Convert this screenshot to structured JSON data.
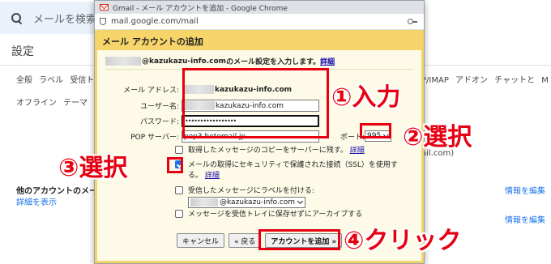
{
  "background": {
    "search_placeholder": "メールを検索",
    "settings_title": "設定",
    "tabs_row1_left": "全般 ラベル 受信ト",
    "tabs_row1_right": "P/IMAP アドオン チャットと M",
    "tabs_row2": "オフライン テーマ",
    "other_accounts_label": "他のアカウントのメー",
    "show_details_link": "詳細を表示",
    "edit_info_1": "情報を編集",
    "edit_info_2": "情報を編集",
    "email_suffix": "ail.com)"
  },
  "browser": {
    "title": "Gmail - メール アカウントを追加 - Google Chrome",
    "url": "mail.google.com/mail"
  },
  "dialog": {
    "header": "メール アカウントの追加",
    "intro_domain": "@kazukazu-info.com",
    "intro_text": " のメール設定を入力します。",
    "details_link": "詳細",
    "fields": {
      "email_label": "メール アドレス:",
      "email_value": "kazukazu-info.com",
      "username_label": "ユーザー名:",
      "username_value": "kazukazu-info.com",
      "password_label": "パスワード:",
      "password_value": "•••••••••••••••••",
      "pop_label": "POP サーバー:",
      "pop_value": "pop3.hetemail.jp",
      "port_label": "ポート:",
      "port_value": "995"
    },
    "options": {
      "leave_copy": "取得したメッセージのコピーをサーバーに残す。",
      "leave_copy_link": "詳細",
      "ssl_line1": "メールの取得にセキュリティで保護された接続（SSL）を使用す",
      "ssl_line2": "る。",
      "ssl_link": "詳細",
      "label_incoming": "受信したメッセージにラベルを付ける:",
      "label_value": "@kazukazu-info.com",
      "archive": "メッセージを受信トレイに保存せずにアーカイブする"
    },
    "buttons": {
      "cancel": "キャンセル",
      "back": "« 戻る",
      "add": "アカウントを追加 »"
    }
  },
  "annotations": {
    "step1": "①入力",
    "step2": "②選択",
    "step3": "③選択",
    "step4": "④クリック",
    "color": "#e60012"
  }
}
